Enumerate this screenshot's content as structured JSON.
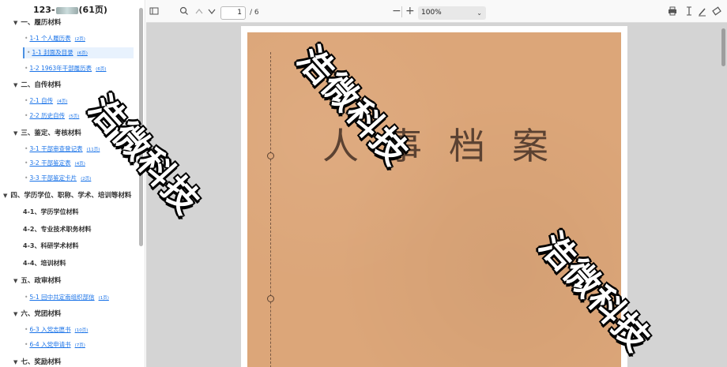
{
  "sidebar": {
    "title_prefix": "123-",
    "title_suffix": "(61页)",
    "sections": [
      {
        "label": "一、履历材料",
        "items": [
          {
            "label": "1-1 个人履历表",
            "count": "(2页)"
          },
          {
            "label": "1-1 封面及目录",
            "count": "(6页)"
          },
          {
            "label": "1-2 1963年干部履历表",
            "count": "(6页)"
          }
        ]
      },
      {
        "label": "二、自传材料",
        "items": [
          {
            "label": "2-1 自传",
            "count": "(4页)"
          },
          {
            "label": "2-2 历史自传",
            "count": "(5页)"
          }
        ]
      },
      {
        "label": "三、鉴定、考核材料",
        "items": [
          {
            "label": "3-1 干部审查登记表",
            "count": "(11页)"
          },
          {
            "label": "3-2 干部鉴定表",
            "count": "(4页)"
          },
          {
            "label": "3-3 干部鉴定卡片",
            "count": "(2页)"
          }
        ]
      },
      {
        "label": "四、学历学位、职称、学术、培训等材料",
        "children": [
          "4-1、学历学位材料",
          "4-2、专业技术职务材料",
          "4-3、科研学术材料",
          "4-4、培训材料"
        ]
      },
      {
        "label": "五、政审材料",
        "items": [
          {
            "label": "5-1 回中共定南组织部信",
            "count": "(1页)"
          }
        ]
      },
      {
        "label": "六、党团材料",
        "items": [
          {
            "label": "6-3 入党志愿书",
            "count": "(10页)"
          },
          {
            "label": "6-4 入党申请书",
            "count": "(7页)"
          }
        ]
      },
      {
        "label": "七、奖励材料"
      }
    ]
  },
  "toolbar": {
    "page_current": "1",
    "page_total": "/ 6",
    "zoom": "100%",
    "minus": "−",
    "plus": "+"
  },
  "document": {
    "heading": "人事档案",
    "heading_visible_left": "人",
    "heading_visible_right": "档案"
  },
  "watermark": "浩微科技",
  "icons": [
    "sidebar-toggle-icon",
    "search-icon",
    "chevron-up-icon",
    "chevron-down-icon",
    "print-icon",
    "text-cursor-icon",
    "pen-icon",
    "eraser-icon"
  ]
}
